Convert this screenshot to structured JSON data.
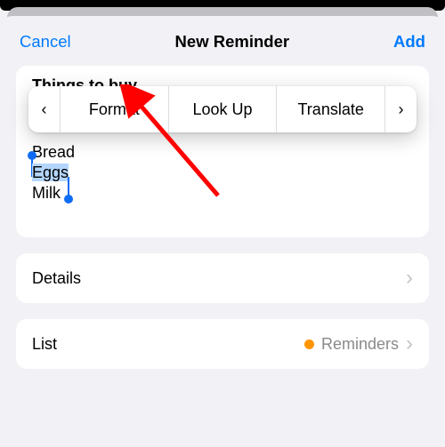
{
  "navbar": {
    "cancel": "Cancel",
    "title": "New Reminder",
    "add": "Add"
  },
  "reminder": {
    "title": "Things to buy",
    "notes": {
      "line1": "Bread",
      "line2_selected": "Eggs",
      "line3": "Milk"
    }
  },
  "context_menu": {
    "prev_icon": "‹",
    "items": [
      "Format",
      "Look Up",
      "Translate"
    ],
    "next_icon": "›"
  },
  "rows": {
    "details": {
      "label": "Details"
    },
    "list": {
      "label": "List",
      "value": "Reminders"
    }
  }
}
